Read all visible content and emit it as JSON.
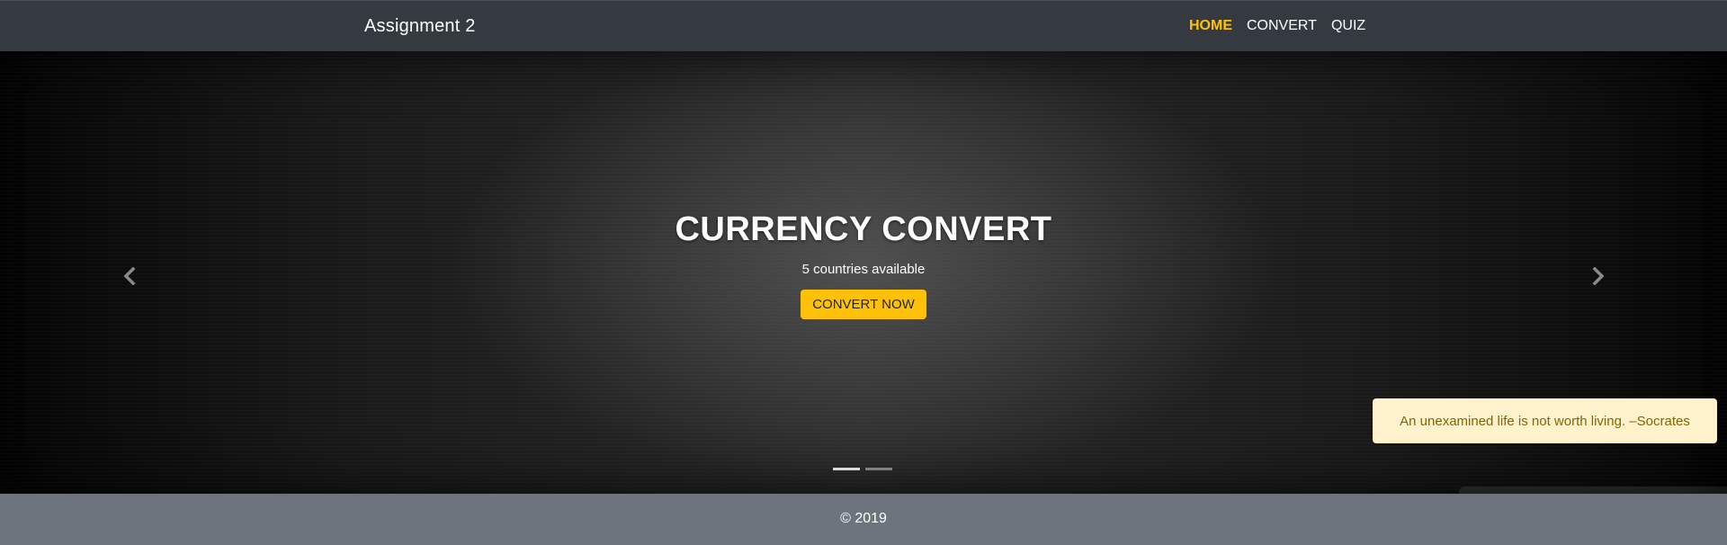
{
  "navbar": {
    "brand": "Assignment 2",
    "links": [
      {
        "label": "HOME",
        "active": true
      },
      {
        "label": "CONVERT",
        "active": false
      },
      {
        "label": "QUIZ",
        "active": false
      }
    ]
  },
  "carousel": {
    "title": "CURRENCY CONVERT",
    "subtitle": "5 countries available",
    "cta_label": "CONVERT NOW",
    "indicators": 2,
    "active_slide": 1
  },
  "toast": {
    "message": "An unexamined life is not worth living. –Socrates"
  },
  "footer": {
    "copyright": "© 2019"
  },
  "colors": {
    "navbar_bg": "#343a40",
    "accent": "#ffc107",
    "footer_bg": "#6c757d",
    "toast_bg": "#fff3cd",
    "toast_text": "#856404"
  },
  "icons": {
    "prev": "chevron-left-icon",
    "next": "chevron-right-icon"
  }
}
